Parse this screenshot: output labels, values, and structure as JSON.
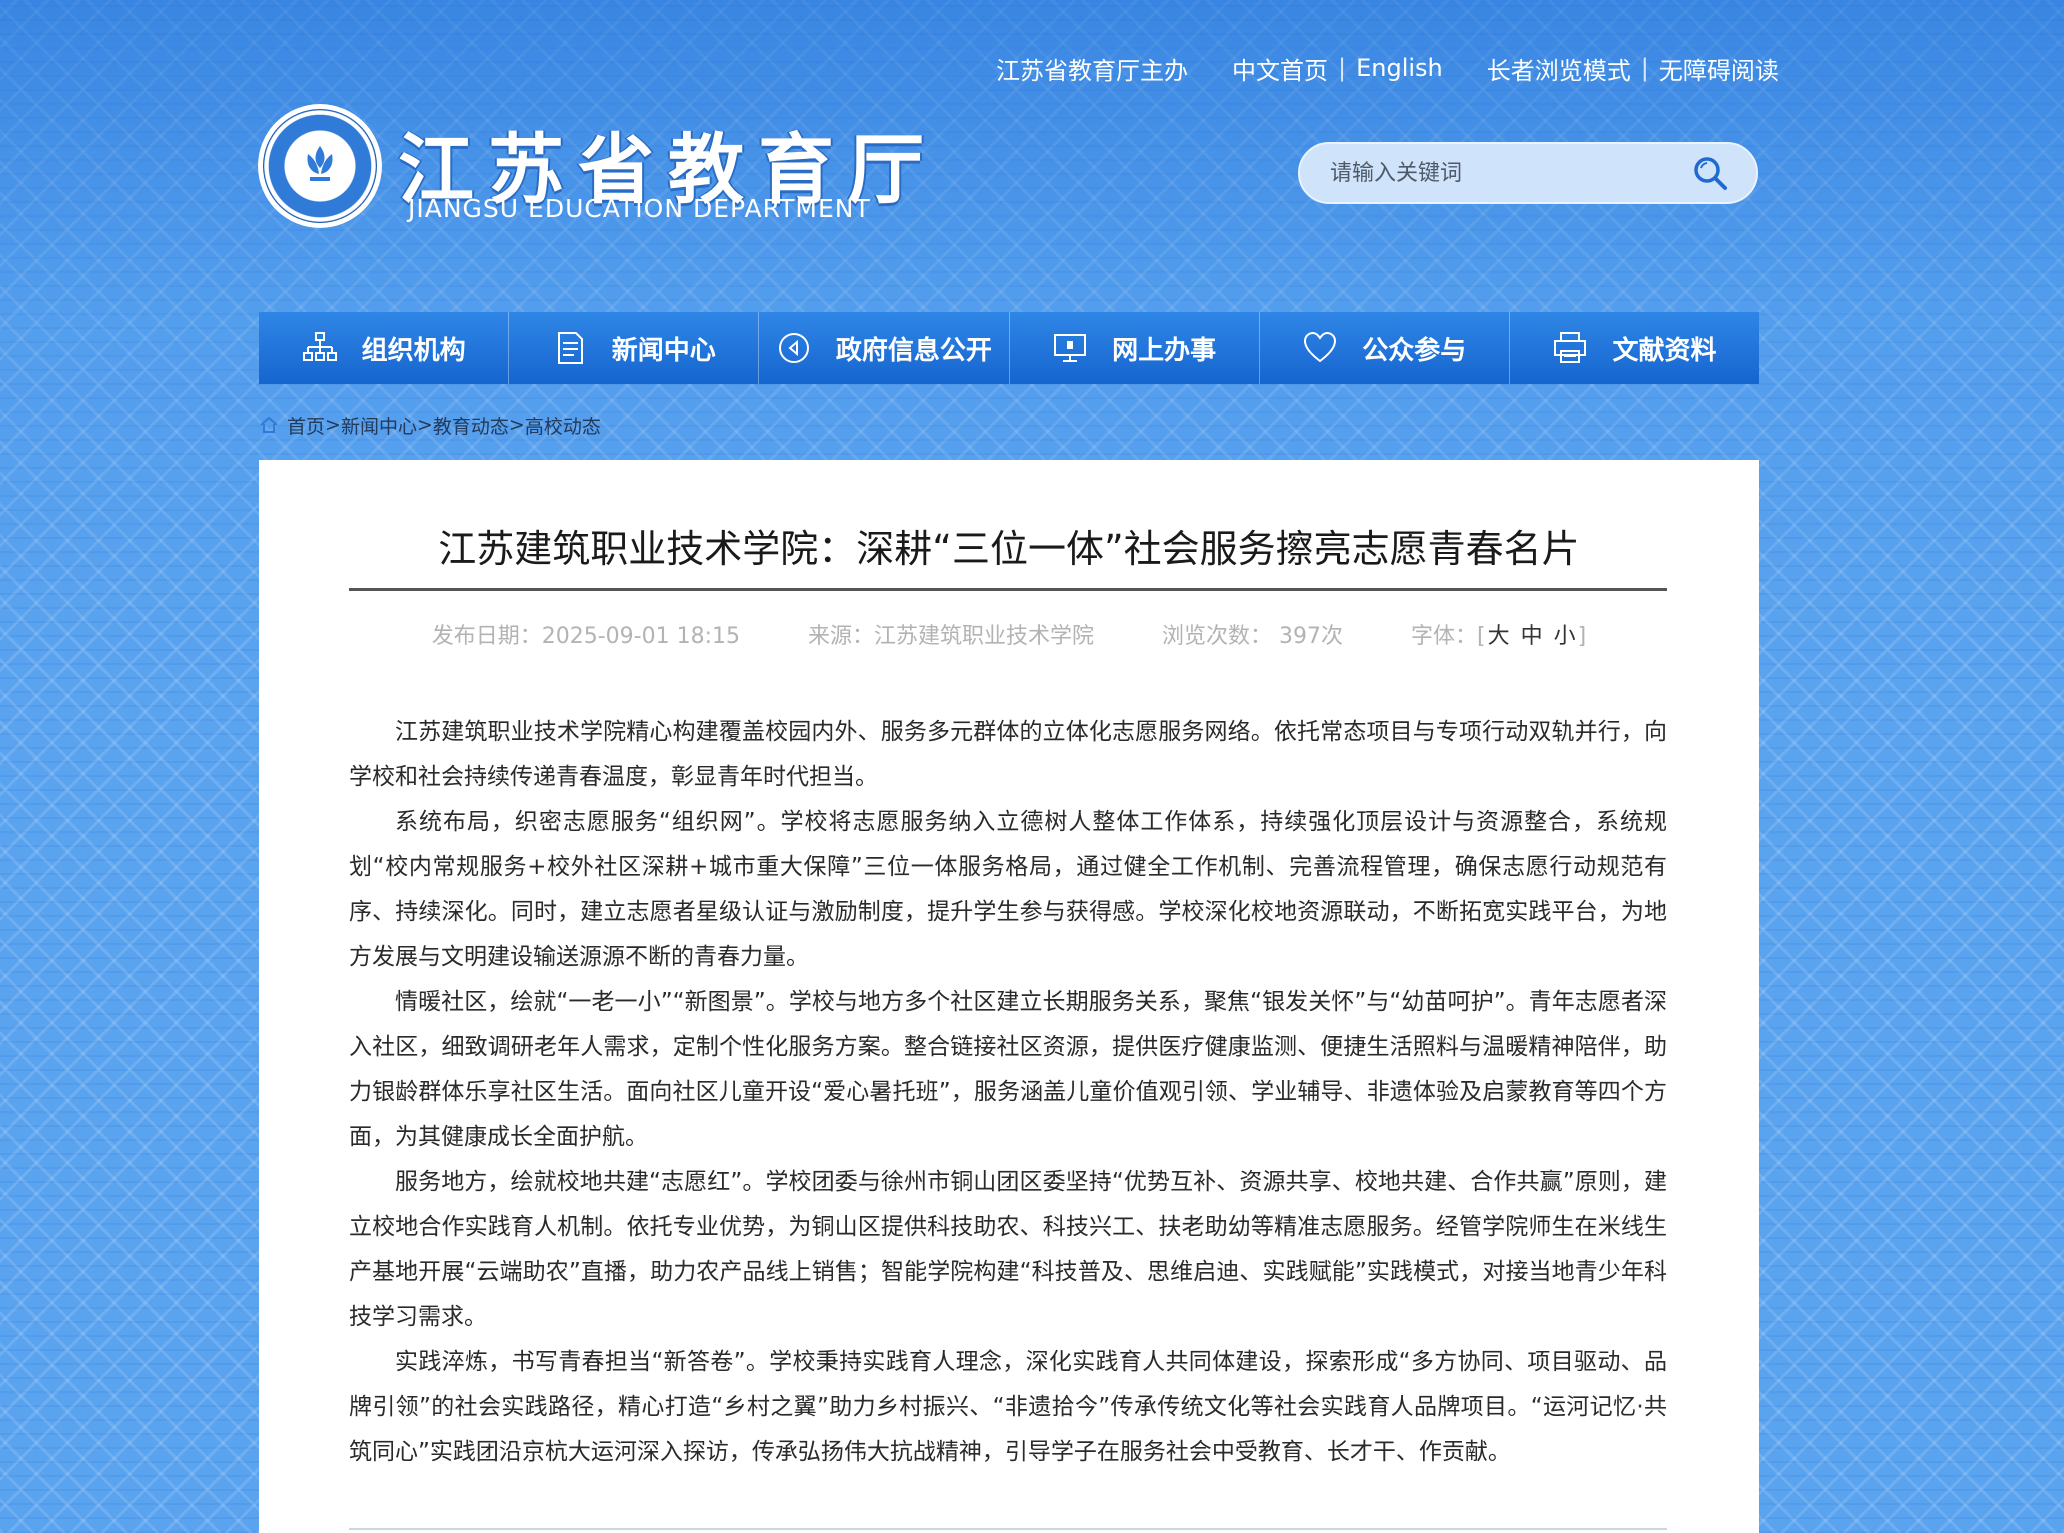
{
  "toplinks": {
    "sponsor": "江苏省教育厅主办",
    "chinese_home": "中文首页",
    "english": "English",
    "elder_mode": "长者浏览模式",
    "accessible": "无障碍阅读"
  },
  "logo": {
    "title": "江苏省教育厅",
    "subtitle": "JIANGSU EDUCATION DEPARTMENT"
  },
  "search": {
    "placeholder": "请输入关键词"
  },
  "nav": {
    "items": [
      {
        "label": "组织机构",
        "icon": "org-chart-icon"
      },
      {
        "label": "新闻中心",
        "icon": "document-icon"
      },
      {
        "label": "政府信息公开",
        "icon": "play-circle-icon"
      },
      {
        "label": "网上办事",
        "icon": "monitor-icon"
      },
      {
        "label": "公众参与",
        "icon": "heart-icon"
      },
      {
        "label": "文献资料",
        "icon": "printer-icon"
      }
    ]
  },
  "breadcrumb": {
    "home": "首页",
    "sep": ">",
    "news": "新闻中心",
    "edu": "教育动态",
    "college": "高校动态"
  },
  "article": {
    "title": "江苏建筑职业技术学院：深耕“三位一体”社会服务擦亮志愿青春名片",
    "date": "发布日期：2025-09-01 18:15",
    "source": "来源：江苏建筑职业技术学院",
    "views": "浏览次数：  397次",
    "font_label": "字体：",
    "font_open": "[",
    "font_large": "大",
    "font_medium": "中",
    "font_small": "小",
    "font_close": "]",
    "paragraphs": [
      "江苏建筑职业技术学院精心构建覆盖校园内外、服务多元群体的立体化志愿服务网络。依托常态项目与专项行动双轨并行，向学校和社会持续传递青春温度，彰显青年时代担当。",
      "系统布局，织密志愿服务“组织网”。学校将志愿服务纳入立德树人整体工作体系，持续强化顶层设计与资源整合，系统规划“校内常规服务+校外社区深耕+城市重大保障”三位一体服务格局，通过健全工作机制、完善流程管理，确保志愿行动规范有序、持续深化。同时，建立志愿者星级认证与激励制度，提升学生参与获得感。学校深化校地资源联动，不断拓宽实践平台，为地方发展与文明建设输送源源不断的青春力量。",
      "情暖社区，绘就“一老一小”“新图景”。学校与地方多个社区建立长期服务关系，聚焦“银发关怀”与“幼苗呵护”。青年志愿者深入社区，细致调研老年人需求，定制个性化服务方案。整合链接社区资源，提供医疗健康监测、便捷生活照料与温暖精神陪伴，助力银龄群体乐享社区生活。面向社区儿童开设“爱心暑托班”，服务涵盖儿童价值观引领、学业辅导、非遗体验及启蒙教育等四个方面，为其健康成长全面护航。",
      "服务地方，绘就校地共建“志愿红”。学校团委与徐州市铜山团区委坚持“优势互补、资源共享、校地共建、合作共赢”原则，建立校地合作实践育人机制。依托专业优势，为铜山区提供科技助农、科技兴工、扶老助幼等精准志愿服务。经管学院师生在米线生产基地开展“云端助农”直播，助力农产品线上销售；智能学院构建“科技普及、思维启迪、实践赋能”实践模式，对接当地青少年科技学习需求。",
      "实践淬炼，书写青春担当“新答卷”。学校秉持实践育人理念，深化实践育人共同体建设，探索形成“多方协同、项目驱动、品牌引领”的社会实践路径，精心打造“乡村之翼”助力乡村振兴、“非遗拾今”传承传统文化等社会实践育人品牌项目。“运河记忆·共筑同心”实践团沿京杭大运河深入探访，传承弘扬伟大抗战精神，引导学子在服务社会中受教育、长才干、作贡献。"
    ]
  },
  "colors": {
    "nav_top": "#2f86e6",
    "nav_bottom": "#1665cf",
    "bg_blue": "#5aa3ef",
    "meta_gray": "#b3b3b3"
  }
}
